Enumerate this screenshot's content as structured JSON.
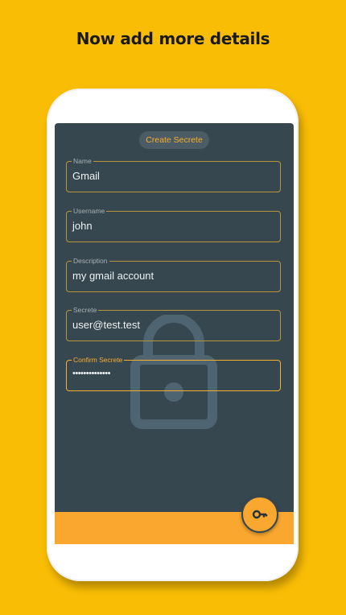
{
  "headline": "Now add more details",
  "app": {
    "title": "Create Secrete",
    "fields": [
      {
        "label": "Name",
        "value": "Gmail"
      },
      {
        "label": "Username",
        "value": "john"
      },
      {
        "label": "Description",
        "value": "my gmail account"
      },
      {
        "label": "Secrete",
        "value": "user@test.test"
      },
      {
        "label": "Confirm Secrete",
        "value": "••••••••••••••"
      }
    ],
    "fab_icon": "key-icon",
    "background_icon": "lock-icon"
  },
  "colors": {
    "page_bg": "#F9BD05",
    "screen_bg": "#37474F",
    "accent": "#F5AE2E",
    "bottom_bar": "#F9A72E"
  }
}
